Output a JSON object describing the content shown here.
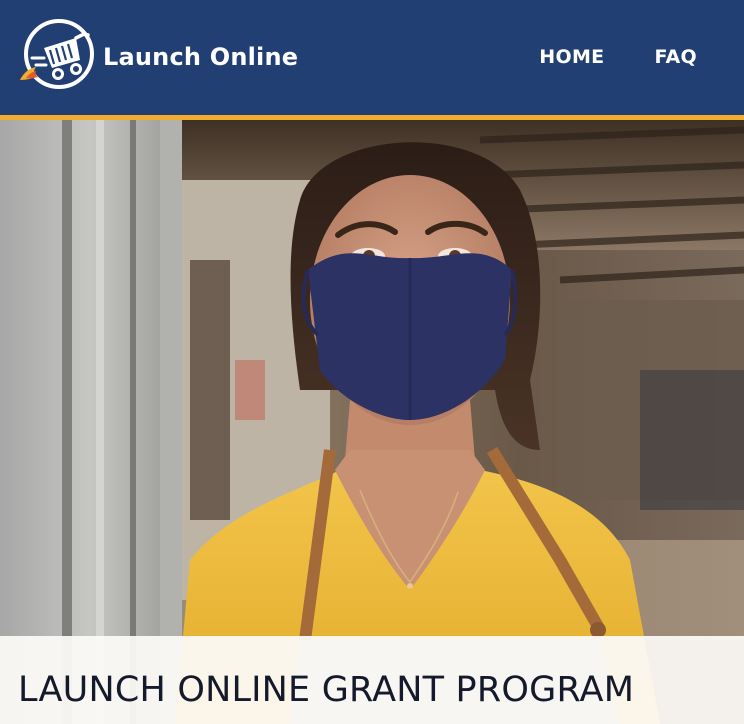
{
  "header": {
    "brand_name": "Launch Online",
    "logo_icon": "shopping-cart-rocket-icon",
    "colors": {
      "background": "#223f73",
      "accent": "#f0ad2e",
      "text": "#ffffff"
    }
  },
  "nav": {
    "items": [
      {
        "label": "HOME"
      },
      {
        "label": "FAQ"
      }
    ]
  },
  "hero": {
    "image": "woman-wearing-navy-face-mask-in-yellow-shirt-and-apron-photo",
    "title": "LAUNCH ONLINE GRANT PROGRAM"
  }
}
